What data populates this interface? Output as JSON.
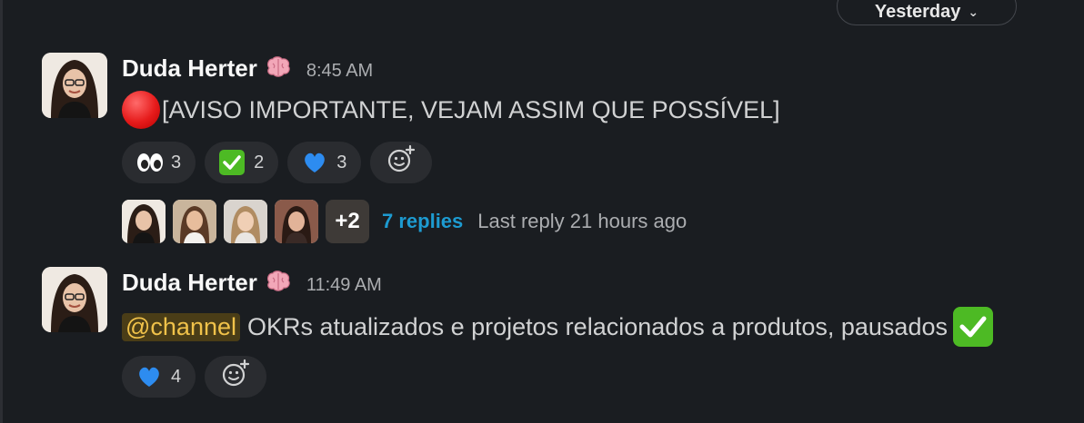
{
  "date_divider": {
    "label": "Yesterday"
  },
  "messages": [
    {
      "sender": "Duda Herter",
      "time": "8:45 AM",
      "text": "[AVISO IMPORTANTE, VEJAM ASSIM QUE POSSÍVEL]",
      "reactions": [
        {
          "emoji": "eyes",
          "count": "3"
        },
        {
          "emoji": "white-check-mark",
          "count": "2"
        },
        {
          "emoji": "blue-heart",
          "count": "3"
        }
      ],
      "thread": {
        "more_count": "+2",
        "replies_label": "7 replies",
        "last_reply": "Last reply 21 hours ago"
      }
    },
    {
      "sender": "Duda Herter",
      "time": "11:49 AM",
      "mention": "@channel",
      "text": "OKRs atualizados e projetos relacionados a produtos, pausados",
      "reactions": [
        {
          "emoji": "blue-heart",
          "count": "4"
        }
      ]
    }
  ],
  "colors": {
    "background": "#1a1d21",
    "link": "#1d9bd1",
    "mention_text": "#f0c24a",
    "mention_bg": "#4a3d17"
  }
}
